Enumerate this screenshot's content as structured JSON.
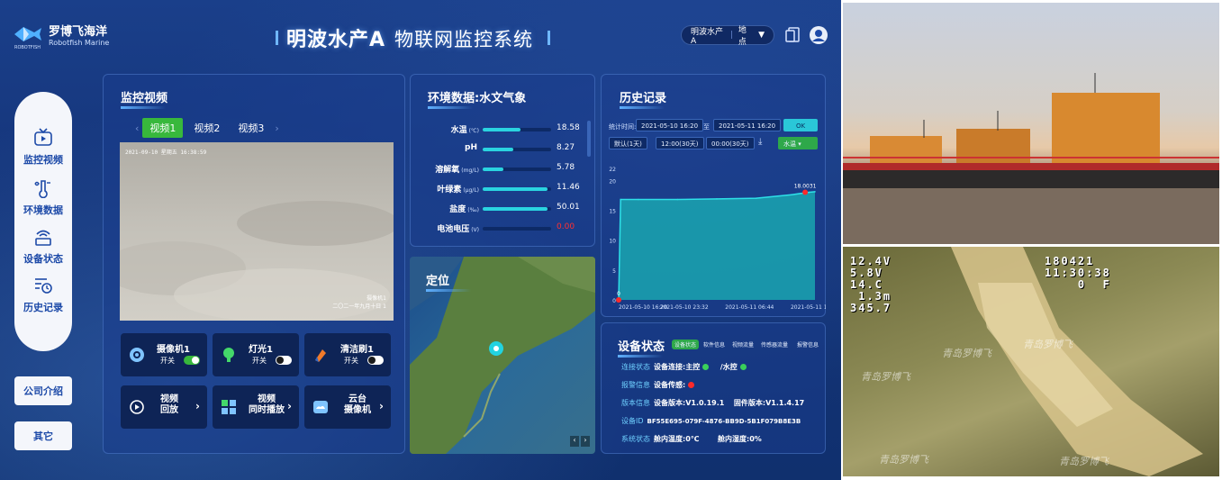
{
  "header": {
    "logo_cn": "罗博飞海洋",
    "logo_en": "Robotfish Marine",
    "logo_small": "ROBOTFISH",
    "title_main": "明波水产A",
    "title_sub": "物联网监控系统",
    "location_pill": "明波水产A",
    "location_select": "地点"
  },
  "sidebar": {
    "items": [
      {
        "label": "监控视频",
        "icon": "tv-icon"
      },
      {
        "label": "环境数据",
        "icon": "thermometer-icon"
      },
      {
        "label": "设备状态",
        "icon": "router-icon"
      },
      {
        "label": "历史记录",
        "icon": "history-icon"
      }
    ],
    "buttons": [
      "公司介绍",
      "其它"
    ]
  },
  "video_panel": {
    "title": "监控视频",
    "tabs": [
      "视频1",
      "视频2",
      "视频3"
    ],
    "active_tab": 0,
    "osd_top": "2021-09-10 星期五 16:38:59",
    "osd_bottom": "摄像机1\n二〇二一年九月十日 1",
    "controls": [
      {
        "name": "摄像机1",
        "switch_label": "开关",
        "on": true
      },
      {
        "name": "灯光1",
        "switch_label": "开关",
        "on": false
      },
      {
        "name": "清洁刷1",
        "switch_label": "开关",
        "on": false
      }
    ],
    "actions": [
      {
        "line1": "视频",
        "line2": "回放"
      },
      {
        "line1": "视频",
        "line2": "同时播放"
      },
      {
        "line1": "云台",
        "line2": "摄像机"
      }
    ]
  },
  "env_panel": {
    "title": "环境数据:水文气象",
    "rows": [
      {
        "label": "水温",
        "unit": "(℃)",
        "value": "18.58",
        "fraction": 0.55,
        "color": "#ffffff"
      },
      {
        "label": "pH",
        "unit": "",
        "value": "8.27",
        "fraction": 0.45,
        "color": "#ffffff"
      },
      {
        "label": "溶解氧",
        "unit": "(mg/L)",
        "value": "5.78",
        "fraction": 0.3,
        "color": "#ffffff"
      },
      {
        "label": "叶绿素",
        "unit": "(μg/L)",
        "value": "11.46",
        "fraction": 0.95,
        "color": "#ffffff"
      },
      {
        "label": "盐度",
        "unit": "(‰)",
        "value": "50.01",
        "fraction": 0.95,
        "color": "#ffffff"
      },
      {
        "label": "电池电压",
        "unit": "(V)",
        "value": "0.00",
        "fraction": 0.0,
        "color": "#ff3030"
      }
    ]
  },
  "map_panel": {
    "title": "定位"
  },
  "history_panel": {
    "title": "历史记录",
    "time_label": "统计时间:",
    "start": "2021-05-10 16:20",
    "to": "至",
    "end": "2021-05-11 16:20",
    "ok": "OK",
    "presets": [
      "默认(1天)",
      "12:00(30天)",
      "00:00(30天)"
    ],
    "metric": "水温"
  },
  "chart_data": {
    "type": "area",
    "title": "",
    "xlabel": "",
    "ylabel": "",
    "x_ticks": [
      "2021-05-10 16:20",
      "2021-05-10 23:32",
      "2021-05-11 06:44",
      "2021-05-11 13:56"
    ],
    "y_ticks": [
      0,
      5,
      10,
      15,
      20,
      22
    ],
    "ylim": [
      0,
      22
    ],
    "series": [
      {
        "values": [
          {
            "x": 0.0,
            "y": 0
          },
          {
            "x": 0.01,
            "y": 16.8
          },
          {
            "x": 0.1,
            "y": 16.8
          },
          {
            "x": 0.3,
            "y": 16.8
          },
          {
            "x": 0.5,
            "y": 16.9
          },
          {
            "x": 0.7,
            "y": 17.0
          },
          {
            "x": 0.88,
            "y": 17.6
          },
          {
            "x": 0.97,
            "y": 18.0
          },
          {
            "x": 1.0,
            "y": 18.1
          }
        ]
      }
    ],
    "annotations": [
      {
        "label": "0",
        "x": 0.0,
        "y": 0
      },
      {
        "label": "18.0031",
        "x": 0.95,
        "y": 18.0
      }
    ],
    "colors": {
      "area": "#1aa6b0",
      "line": "#2ee0e8",
      "marker": "#ff2a2a"
    }
  },
  "device_panel": {
    "title": "设备状态",
    "tabs": [
      "设备状态",
      "软件信息",
      "视频流量",
      "传感器流量",
      "报警信息"
    ],
    "rows": [
      {
        "key": "连接状态",
        "value": "设备连接:主控",
        "extra": "/水控"
      },
      {
        "key": "报警信息",
        "value": "设备传感:",
        "extra": ""
      },
      {
        "key": "版本信息",
        "value": "设备版本:V1.0.19.1",
        "extra": "固件版本:V1.1.4.17"
      },
      {
        "key": "设备ID",
        "value": "BF55E695-079F-4876-BB9D-5B1F079B8E3B",
        "extra": ""
      },
      {
        "key": "系统状态",
        "value": "舱内温度:0℃",
        "extra": "舱内湿度:0%"
      }
    ]
  },
  "underwater_osd": {
    "left_lines": "12.4V\n5.8V\n14.C\n 1.3m\n345.7",
    "right_lines": "180421\n11:30:38\n    0  F",
    "watermark": "青岛罗博飞"
  }
}
